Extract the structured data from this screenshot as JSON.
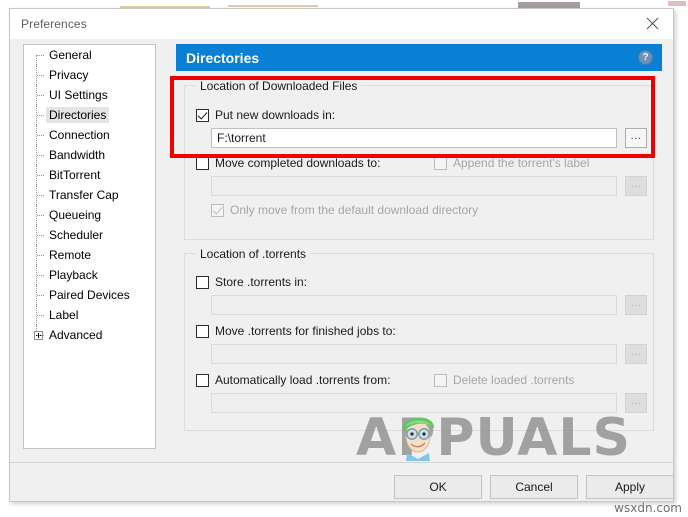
{
  "window": {
    "title": "Preferences",
    "close_label": "✕"
  },
  "sidebar": {
    "items": [
      {
        "label": "General",
        "selected": false,
        "expandable": false
      },
      {
        "label": "Privacy",
        "selected": false,
        "expandable": false
      },
      {
        "label": "UI Settings",
        "selected": false,
        "expandable": false
      },
      {
        "label": "Directories",
        "selected": true,
        "expandable": false
      },
      {
        "label": "Connection",
        "selected": false,
        "expandable": false
      },
      {
        "label": "Bandwidth",
        "selected": false,
        "expandable": false
      },
      {
        "label": "BitTorrent",
        "selected": false,
        "expandable": false
      },
      {
        "label": "Transfer Cap",
        "selected": false,
        "expandable": false
      },
      {
        "label": "Queueing",
        "selected": false,
        "expandable": false
      },
      {
        "label": "Scheduler",
        "selected": false,
        "expandable": false
      },
      {
        "label": "Remote",
        "selected": false,
        "expandable": false
      },
      {
        "label": "Playback",
        "selected": false,
        "expandable": false
      },
      {
        "label": "Paired Devices",
        "selected": false,
        "expandable": false
      },
      {
        "label": "Label",
        "selected": false,
        "expandable": false
      },
      {
        "label": "Advanced",
        "selected": false,
        "expandable": true
      }
    ]
  },
  "panel": {
    "title": "Directories",
    "help_icon": "?",
    "header_color": "#0a7fd6",
    "downloads_group": {
      "legend": "Location of Downloaded Files",
      "put_new_downloads": {
        "label": "Put new downloads in:",
        "checked": true,
        "value": "F:\\torrent",
        "browse_label": "..."
      },
      "move_completed": {
        "label": "Move completed downloads to:",
        "checked": false,
        "value": "",
        "browse_label": "..."
      },
      "append_label": {
        "label": "Append the torrent's label",
        "checked": false
      },
      "only_move_default": {
        "label": "Only move from the default download directory",
        "checked": true
      }
    },
    "torrents_group": {
      "legend": "Location of .torrents",
      "store_torrents": {
        "label": "Store .torrents in:",
        "checked": false,
        "value": "",
        "browse_label": "..."
      },
      "move_finished": {
        "label": "Move .torrents for finished jobs to:",
        "checked": false,
        "value": "",
        "browse_label": "..."
      },
      "auto_load": {
        "label": "Automatically load .torrents from:",
        "checked": false,
        "value": "",
        "browse_label": "..."
      },
      "delete_loaded": {
        "label": "Delete loaded .torrents",
        "checked": false
      }
    }
  },
  "footer": {
    "ok": "OK",
    "cancel": "Cancel",
    "apply": "Apply"
  },
  "annotation": {
    "highlight_color": "#ee0000"
  },
  "watermarks": {
    "appuals": "APPUALS",
    "appuals_prefix": "A",
    "appuals_suffix": "PUALS",
    "wsxdn": "wsxdn.com"
  }
}
